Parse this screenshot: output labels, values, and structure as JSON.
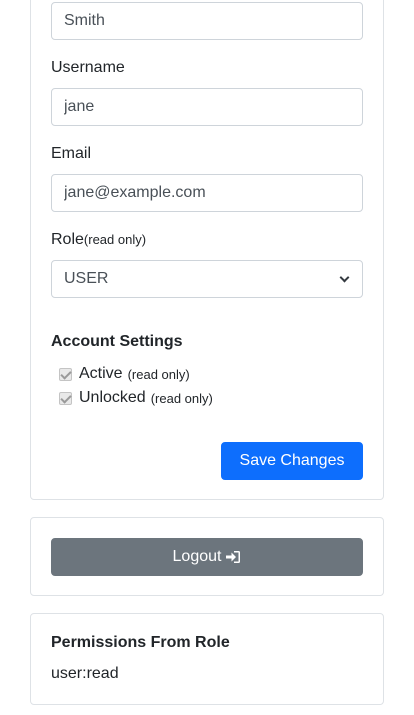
{
  "profile": {
    "last_name_value": "Smith",
    "username_label": "Username",
    "username_value": "jane",
    "email_label": "Email",
    "email_value": "jane@example.com",
    "role_label": "Role",
    "role_note": "(read only)",
    "role_value": "USER",
    "account_settings_title": "Account Settings",
    "active_label": "Active",
    "active_note": "(read only)",
    "unlocked_label": "Unlocked",
    "unlocked_note": "(read only)",
    "save_label": "Save Changes"
  },
  "logout": {
    "label": "Logout"
  },
  "permissions": {
    "title": "Permissions From Role",
    "items": [
      "user:read"
    ]
  },
  "colors": {
    "primary": "#0d6efd",
    "secondary": "#6c757d",
    "border": "#dee2e6"
  }
}
